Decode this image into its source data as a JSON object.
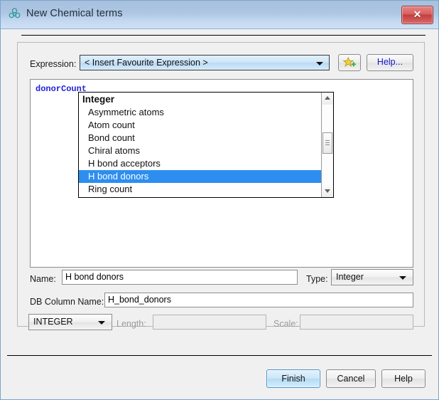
{
  "window": {
    "title": "New Chemical terms",
    "icon": "molecule-icon",
    "close_label": "✕"
  },
  "expression": {
    "label": "Expression:",
    "combo_value": "< Insert Favourite Expression >",
    "favourite_button_icon": "star-plus-icon",
    "help_button_label": "Help...",
    "editor_code": "donorCount"
  },
  "dropdown": {
    "open": true,
    "highlight_color": "#2e8ef0",
    "items": [
      {
        "label": "Integer",
        "type": "group",
        "selected": false
      },
      {
        "label": "Asymmetric atoms",
        "type": "child",
        "selected": false
      },
      {
        "label": "Atom count",
        "type": "child",
        "selected": false
      },
      {
        "label": "Bond count",
        "type": "child",
        "selected": false
      },
      {
        "label": "Chiral atoms",
        "type": "child",
        "selected": false
      },
      {
        "label": "H bond acceptors",
        "type": "child",
        "selected": false
      },
      {
        "label": "H bond donors",
        "type": "child",
        "selected": true
      },
      {
        "label": "Ring count",
        "type": "child",
        "selected": false
      }
    ],
    "scroll_up_icon": "triangle-up-icon",
    "scroll_down_icon": "triangle-down-icon"
  },
  "form": {
    "name_label": "Name:",
    "name_value": "H bond donors",
    "type_label": "Type:",
    "type_value": "Integer",
    "db_column_label": "DB Column Name:",
    "db_column_value": "H_bond_donors",
    "sql_type_value": "INTEGER",
    "length_label": "Length:",
    "length_value": "",
    "scale_label": "Scale:",
    "scale_value": ""
  },
  "footer": {
    "finish_label": "Finish",
    "cancel_label": "Cancel",
    "help_label": "Help"
  }
}
